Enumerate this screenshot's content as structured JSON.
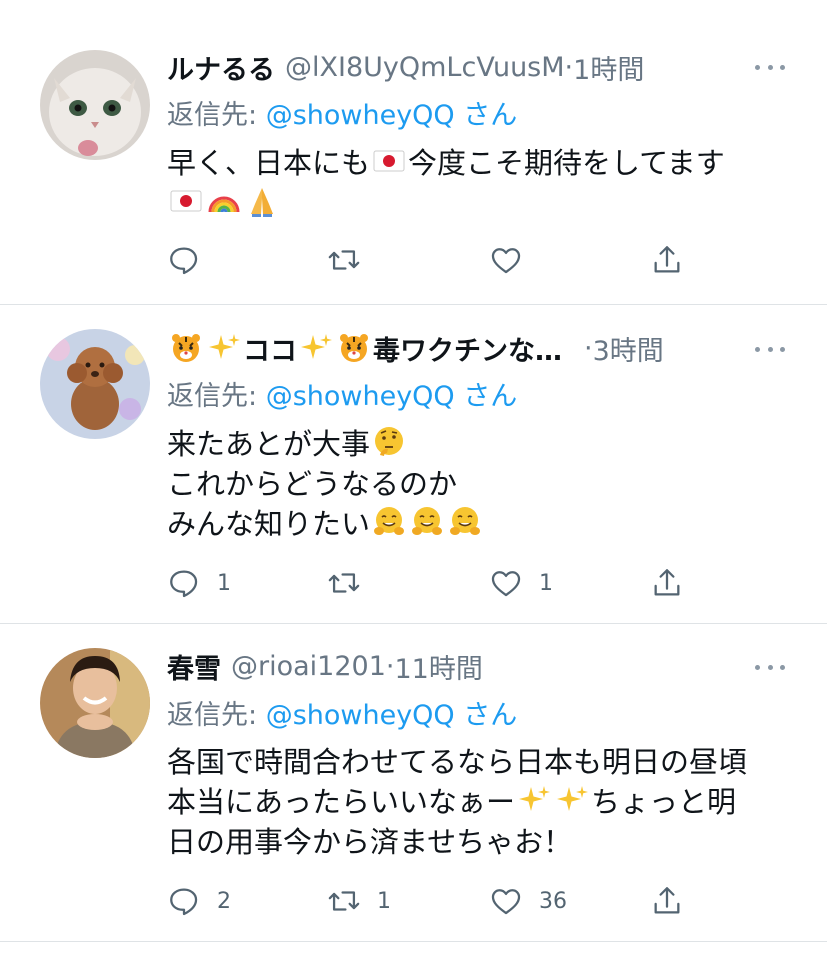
{
  "tweets": [
    {
      "name": "ルナるる",
      "handle": "@lXI8UyQmLcVuusM",
      "dot": "·",
      "time": "1時間",
      "reply_label": "返信先: ",
      "reply_mention": "@showheyQQ",
      "reply_suffix": " さん",
      "body": [
        "早く、日本にも",
        "今度こそ期待をしてます"
      ],
      "reply_count": "",
      "retweet_count": "",
      "like_count": ""
    },
    {
      "name": "ココ",
      "name_rest": "毒ワクチンな…",
      "dot": "·",
      "time": "3時間",
      "reply_label": "返信先: ",
      "reply_mention": "@showheyQQ",
      "reply_suffix": " さん",
      "body": [
        "来たあとが大事",
        "これからどうなるのか",
        "みんな知りたい"
      ],
      "reply_count": "1",
      "retweet_count": "",
      "like_count": "1"
    },
    {
      "name": "春雪",
      "handle": "@rioai1201",
      "dot": "·",
      "time": "11時間",
      "reply_label": "返信先: ",
      "reply_mention": "@showheyQQ",
      "reply_suffix": " さん",
      "body": [
        "各国で時間合わせてるなら日本も明日の昼頃",
        "本当にあったらいいなぁー",
        "ちょっと明",
        "日の用事今から済ませちゃお！"
      ],
      "reply_count": "2",
      "retweet_count": "1",
      "like_count": "36"
    }
  ],
  "colors": {
    "link": "#1d9bf0",
    "secondary": "#687684",
    "divider": "#dfe3e6"
  },
  "icons": [
    "reply-icon",
    "retweet-icon",
    "like-icon",
    "share-icon",
    "more-icon",
    "japan-flag-emoji",
    "rainbow-emoji",
    "folded-hands-emoji",
    "tiger-emoji",
    "sparkles-emoji",
    "thinking-face-emoji",
    "hugging-face-emoji"
  ]
}
